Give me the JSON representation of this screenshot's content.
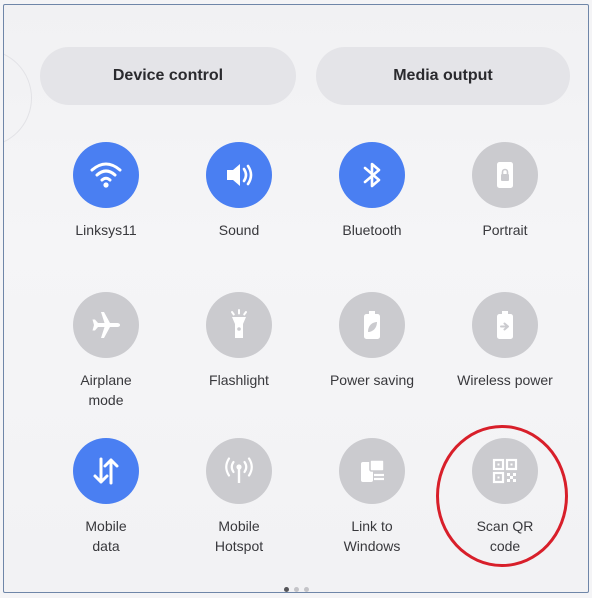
{
  "header": {
    "device_control": "Device control",
    "media_output": "Media output"
  },
  "tiles": [
    {
      "label": "Linksys11",
      "icon": "wifi-icon",
      "active": true
    },
    {
      "label": "Sound",
      "icon": "speaker-icon",
      "active": true
    },
    {
      "label": "Bluetooth",
      "icon": "bluetooth-icon",
      "active": true
    },
    {
      "label": "Portrait",
      "icon": "portrait-lock-icon",
      "active": false
    },
    {
      "label": "Airplane\nmode",
      "icon": "airplane-icon",
      "active": false
    },
    {
      "label": "Flashlight",
      "icon": "flashlight-icon",
      "active": false
    },
    {
      "label": "Power saving",
      "icon": "battery-leaf-icon",
      "active": false
    },
    {
      "label": "Wireless power",
      "icon": "battery-arrow-icon",
      "active": false
    },
    {
      "label": "Mobile\ndata",
      "icon": "data-arrows-icon",
      "active": true
    },
    {
      "label": "Mobile\nHotspot",
      "icon": "hotspot-icon",
      "active": false
    },
    {
      "label": "Link to\nWindows",
      "icon": "link-windows-icon",
      "active": false
    },
    {
      "label": "Scan QR\ncode",
      "icon": "qr-code-icon",
      "active": false
    }
  ],
  "pager": {
    "pages": 3,
    "current": 1
  },
  "colors": {
    "active": "#4a7ff2",
    "inactive": "#cbcbcf",
    "highlight": "#d81f2a"
  }
}
